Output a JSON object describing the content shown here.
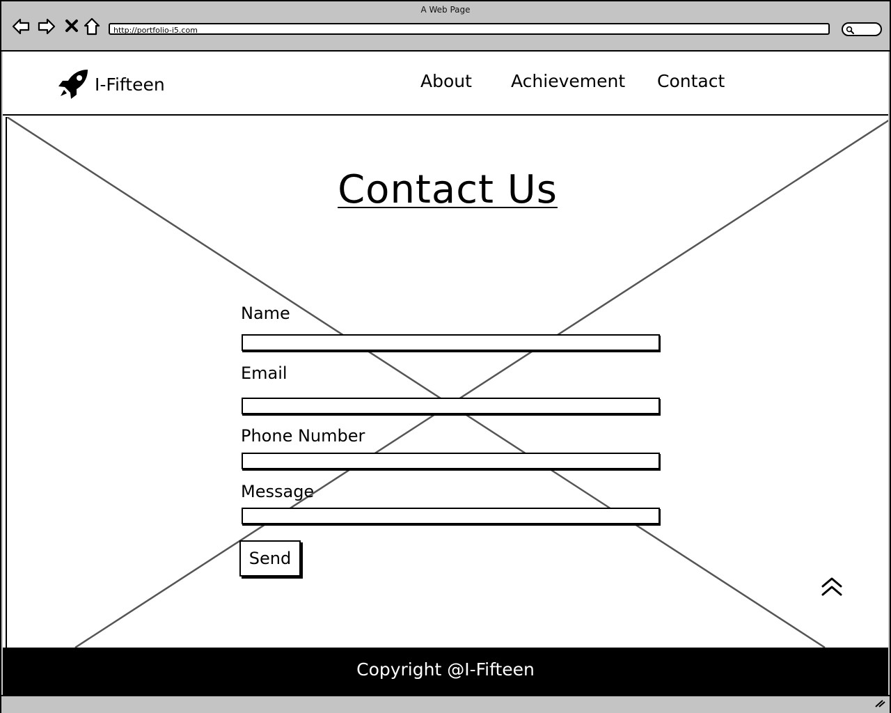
{
  "window": {
    "title": "A Web Page",
    "url": "http://portfolio-i5.com"
  },
  "header": {
    "brand_name": "I-Fifteen",
    "brand_icon": "rocket-icon",
    "nav": [
      {
        "label": "About"
      },
      {
        "label": "Achievement"
      },
      {
        "label": "Contact"
      }
    ]
  },
  "contact": {
    "heading": "Contact Us",
    "fields": [
      {
        "label": "Name",
        "value": ""
      },
      {
        "label": "Email",
        "value": ""
      },
      {
        "label": "Phone Number",
        "value": ""
      },
      {
        "label": "Message",
        "value": ""
      }
    ],
    "send_label": "Send",
    "scroll_top_icon": "double-chevron-up-icon"
  },
  "footer": {
    "text": "Copyright @I-Fifteen"
  }
}
